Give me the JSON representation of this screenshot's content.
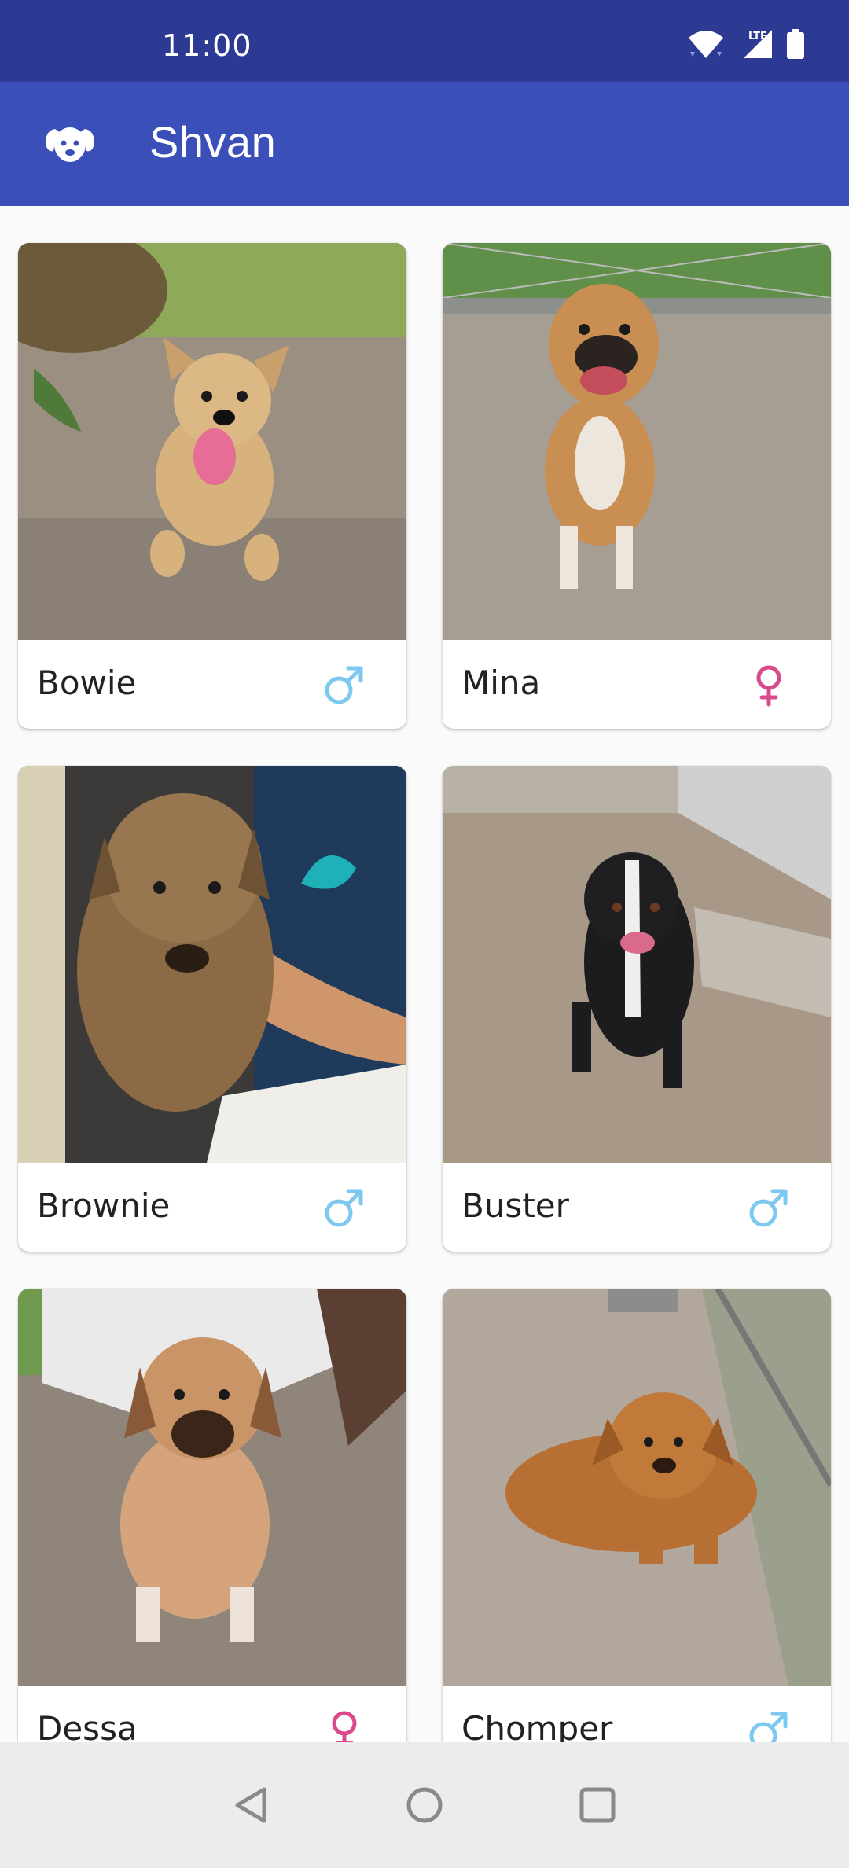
{
  "status_bar": {
    "time": "11:00",
    "network": "LTE"
  },
  "app_bar": {
    "title": "Shvan",
    "logo_icon": "dog-face-icon"
  },
  "colors": {
    "male": "#7cc8ef",
    "female": "#d94a8c",
    "status_bar": "#2c3a94",
    "app_bar": "#3b4fb8"
  },
  "pets": [
    {
      "name": "Bowie",
      "gender": "male"
    },
    {
      "name": "Mina",
      "gender": "female"
    },
    {
      "name": "Brownie",
      "gender": "male"
    },
    {
      "name": "Buster",
      "gender": "male"
    },
    {
      "name": "Dessa",
      "gender": "female"
    },
    {
      "name": "Chomper",
      "gender": "male"
    }
  ],
  "nav": {
    "back_icon": "back-triangle-icon",
    "home_icon": "home-circle-icon",
    "recents_icon": "recents-square-icon"
  }
}
